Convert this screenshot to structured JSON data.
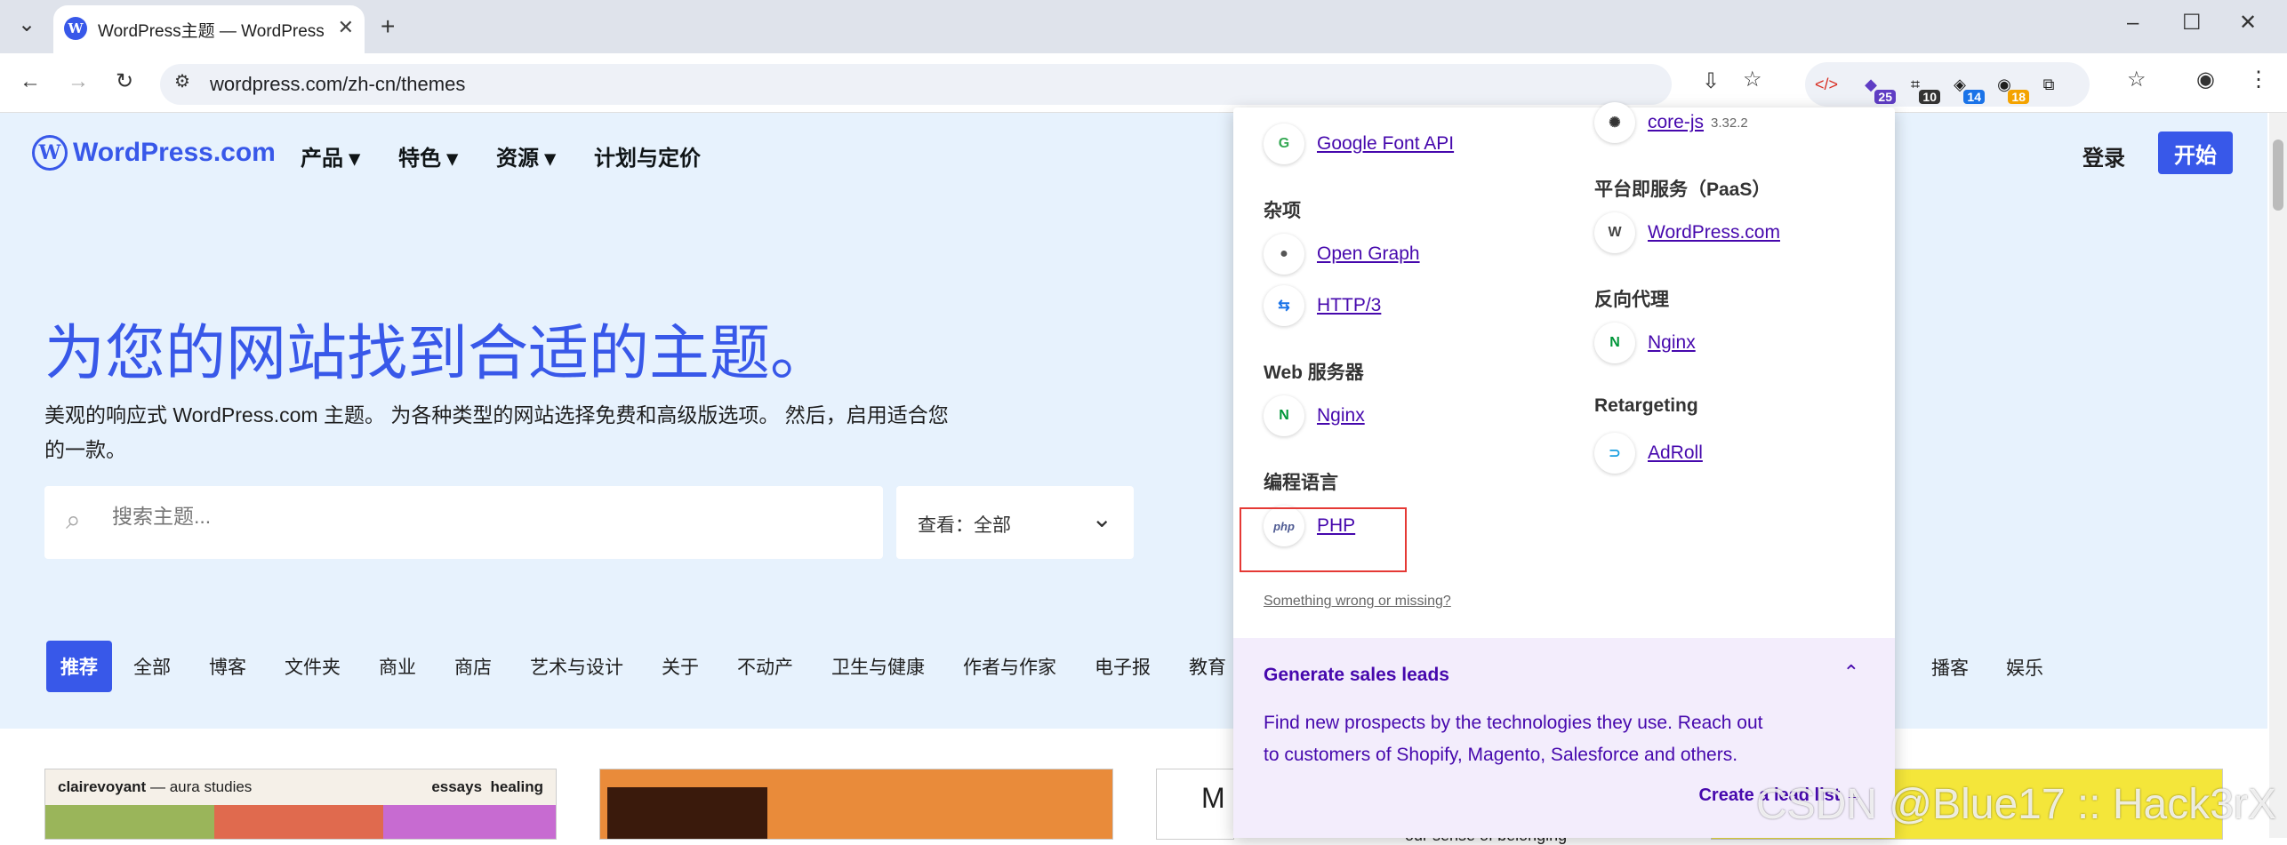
{
  "browser": {
    "tab_title": "WordPress主题 — WordPress",
    "url": "wordpress.com/zh-cn/themes",
    "extensions": [
      {
        "icon": "code-icon",
        "badge": ""
      },
      {
        "icon": "wappalyzer-icon",
        "badge": "25",
        "badge_color": "#5f3dc4"
      },
      {
        "icon": "ext-icon",
        "badge": "10",
        "badge_color": "#333"
      },
      {
        "icon": "ext-icon",
        "badge": "14",
        "badge_color": "#1a73e8"
      },
      {
        "icon": "ext-icon",
        "badge": "18",
        "badge_color": "#f4a300"
      },
      {
        "icon": "puzzle-icon",
        "badge": ""
      }
    ]
  },
  "header": {
    "logo": "WordPress.com",
    "nav": [
      "产品 ▾",
      "特色 ▾",
      "资源 ▾",
      "计划与定价"
    ],
    "login": "登录",
    "start": "开始"
  },
  "hero": {
    "title": "为您的网站找到合适的主题。",
    "subtitle": "美观的响应式 WordPress.com 主题。 为各种类型的网站选择免费和高级版选项。 然后，启用适合您的一款。",
    "search_placeholder": "搜索主题...",
    "view_label": "查看：全部"
  },
  "categories": [
    "推荐",
    "全部",
    "博客",
    "文件夹",
    "商业",
    "商店",
    "艺术与设计",
    "关于",
    "不动产",
    "卫生与健康",
    "作者与作家",
    "电子报",
    "教育"
  ],
  "categories_right": [
    "播客",
    "娱乐"
  ],
  "thumbs": {
    "t1_brand": "clairevoyant",
    "t1_sub": "— aura studies",
    "t1_links": "essays  healing",
    "t3_letter": "M",
    "t3_caption": "our sense of belonging"
  },
  "popup": {
    "left": [
      {
        "section": "",
        "items": [
          {
            "name": "Google Font API",
            "icon": "google-font-icon"
          }
        ]
      },
      {
        "section": "杂项",
        "items": [
          {
            "name": "Open Graph",
            "icon": "open-graph-icon"
          },
          {
            "name": "HTTP/3",
            "icon": "http3-icon"
          }
        ]
      },
      {
        "section": "Web 服务器",
        "items": [
          {
            "name": "Nginx",
            "icon": "nginx-icon"
          }
        ]
      },
      {
        "section": "编程语言",
        "items": [
          {
            "name": "PHP",
            "icon": "php-icon"
          }
        ]
      }
    ],
    "right": [
      {
        "section": "",
        "items": [
          {
            "name": "core-js",
            "version": "3.32.2",
            "icon": "core-js-icon"
          }
        ]
      },
      {
        "section": "平台即服务（PaaS）",
        "items": [
          {
            "name": "WordPress.com",
            "icon": "wordpress-icon"
          }
        ]
      },
      {
        "section": "反向代理",
        "items": [
          {
            "name": "Nginx",
            "icon": "nginx-icon"
          }
        ]
      },
      {
        "section": "Retargeting",
        "items": [
          {
            "name": "AdRoll",
            "icon": "adroll-icon"
          }
        ]
      }
    ],
    "wrong": "Something wrong or missing?",
    "leads_title": "Generate sales leads",
    "leads_text": "Find new prospects by the technologies they use. Reach out to customers of Shopify, Magento, Salesforce and others.",
    "leads_cta": "Create a lead list"
  },
  "watermark": "CSDN @Blue17 :: Hack3rX"
}
